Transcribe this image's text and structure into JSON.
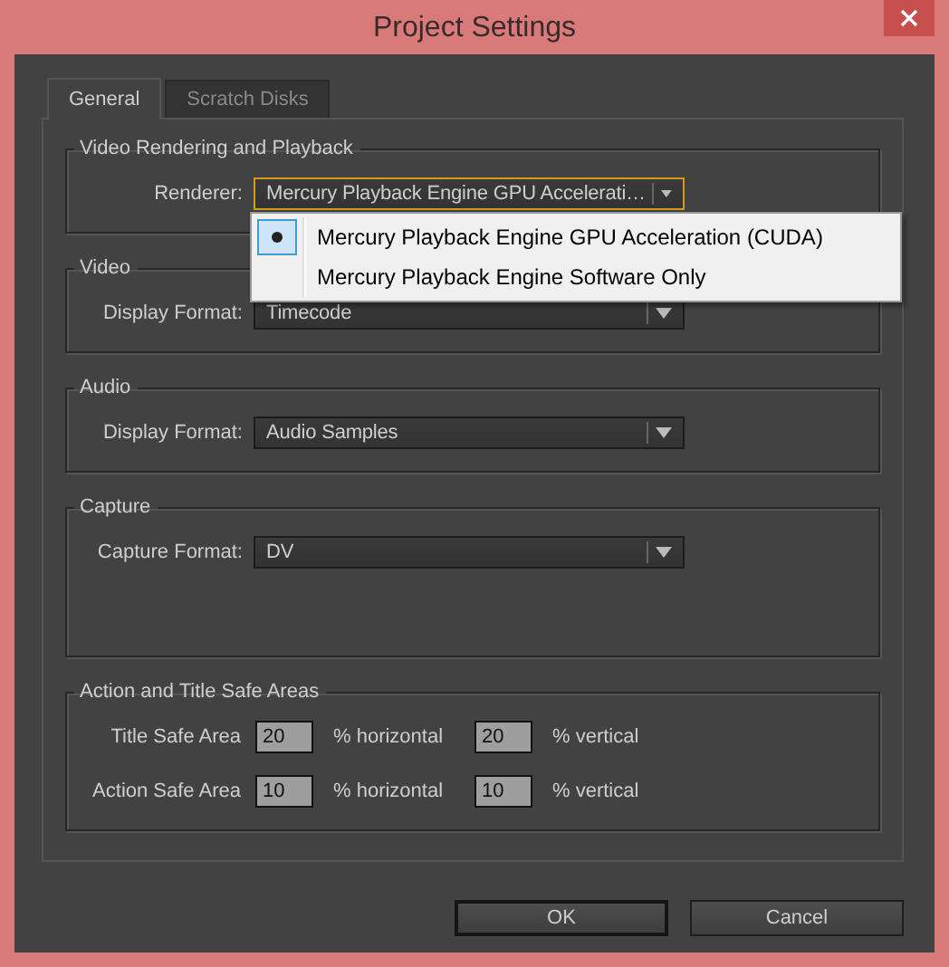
{
  "window": {
    "title": "Project Settings"
  },
  "tabs": [
    {
      "label": "General",
      "selected": true
    },
    {
      "label": "Scratch Disks",
      "selected": false
    }
  ],
  "groups": [
    {
      "kind": "selects",
      "title": "Video Rendering and Playback",
      "fields": [
        {
          "label": "Renderer:",
          "value": "Mercury Playback Engine GPU Accelerati…",
          "focused": true
        }
      ]
    },
    {
      "kind": "selects",
      "title": "Video",
      "fields": [
        {
          "label": "Display Format:",
          "value": "Timecode",
          "focused": false
        }
      ]
    },
    {
      "kind": "selects",
      "title": "Audio",
      "fields": [
        {
          "label": "Display Format:",
          "value": "Audio Samples",
          "focused": false
        }
      ]
    },
    {
      "kind": "selects",
      "title": "Capture",
      "fields": [
        {
          "label": "Capture Format:",
          "value": "DV",
          "focused": false
        }
      ]
    },
    {
      "kind": "safe_areas",
      "title": "Action and Title Safe Areas",
      "rows": [
        {
          "label": "Title Safe Area",
          "horizontal": "20",
          "horizontal_unit": "% horizontal",
          "vertical": "20",
          "vertical_unit": "% vertical"
        },
        {
          "label": "Action Safe Area",
          "horizontal": "10",
          "horizontal_unit": "% horizontal",
          "vertical": "10",
          "vertical_unit": "% vertical"
        }
      ]
    }
  ],
  "dropdown_menu": {
    "items": [
      {
        "label": "Mercury Playback Engine GPU Acceleration (CUDA)",
        "selected": true
      },
      {
        "label": "Mercury Playback Engine Software Only",
        "selected": false
      }
    ]
  },
  "buttons": [
    {
      "label": "OK",
      "default": true
    },
    {
      "label": "Cancel",
      "default": false
    }
  ]
}
